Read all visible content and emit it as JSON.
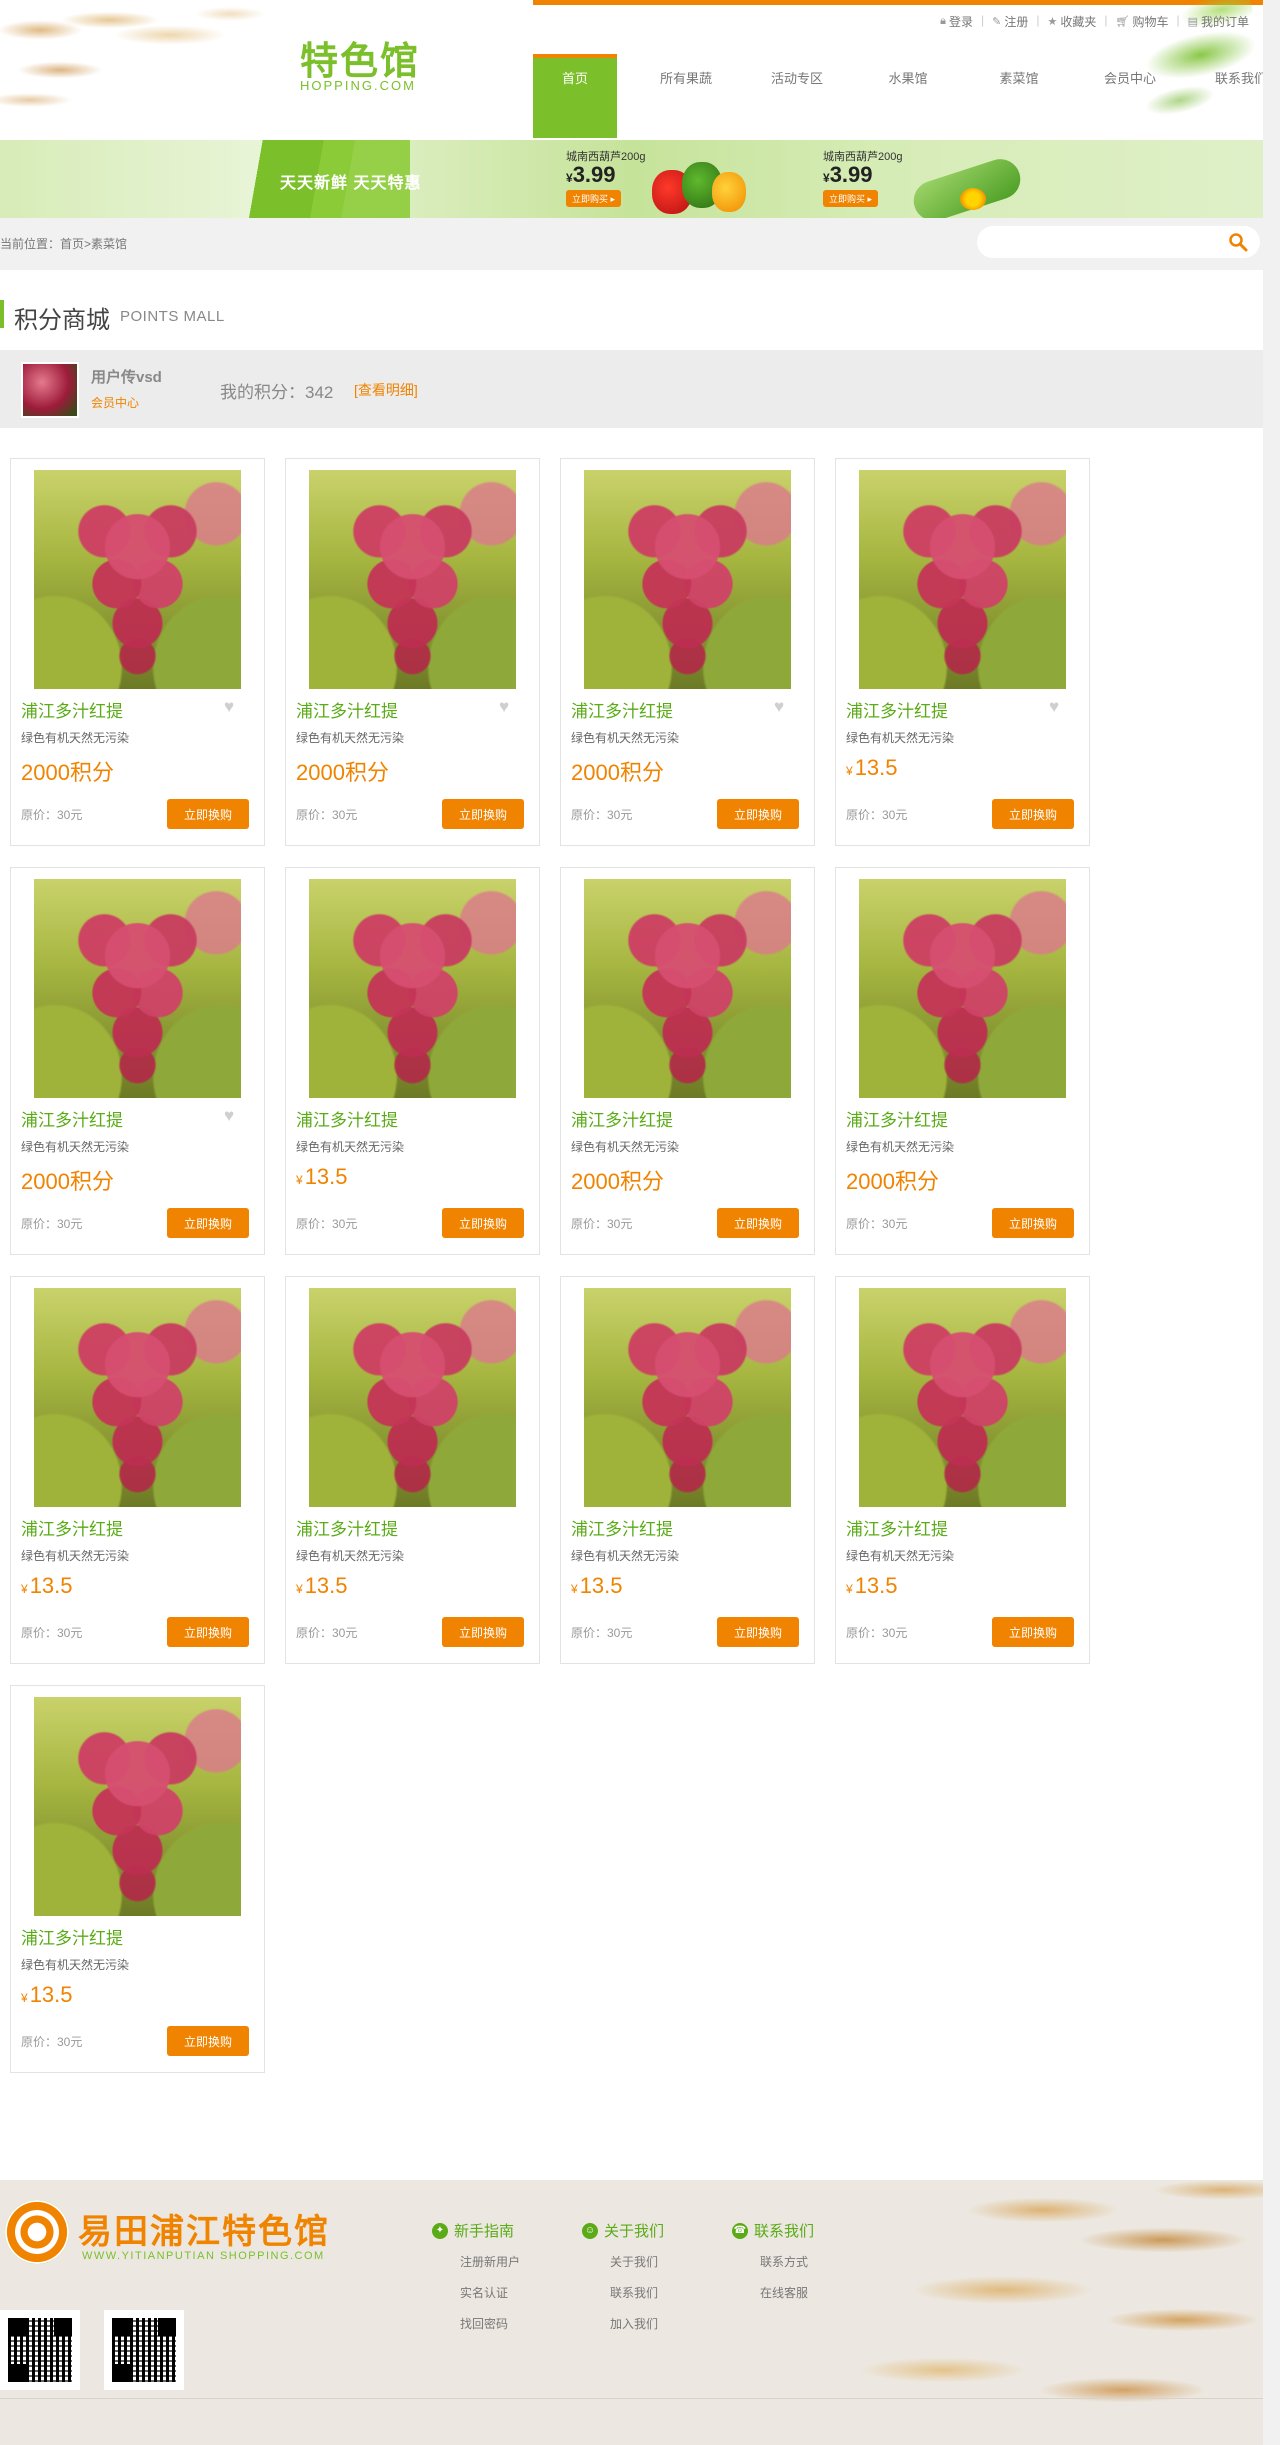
{
  "header": {
    "logo_cn": "特色馆",
    "logo_en": "HOPPING.COM",
    "top_links": [
      {
        "label": "登录",
        "icon": "lock-icon"
      },
      {
        "label": "注册",
        "icon": "pen-icon"
      },
      {
        "label": "收藏夹",
        "icon": "star-icon"
      },
      {
        "label": "购物车",
        "icon": "cart-icon"
      },
      {
        "label": "我的订单",
        "icon": "order-icon"
      }
    ],
    "nav": [
      "首页",
      "所有果蔬",
      "活动专区",
      "水果馆",
      "素菜馆",
      "会员中心",
      "联系我们"
    ],
    "nav_active": 0
  },
  "banner": {
    "slogan": "天天新鲜  天天特惠",
    "promos": [
      {
        "title": "城南西葫芦200g",
        "currency": "¥",
        "price": "3.99",
        "buy_label": "立即购买 ▸"
      },
      {
        "title": "城南西葫芦200g",
        "currency": "¥",
        "price": "3.99",
        "buy_label": "立即购买 ▸"
      }
    ]
  },
  "breadcrumb": {
    "prefix": "当前位置：",
    "path": "首页>素菜馆"
  },
  "search": {
    "placeholder": ""
  },
  "section": {
    "title_cn": "积分商城",
    "title_en": "POINTS MALL"
  },
  "user": {
    "name": "用户传vsd",
    "member_link": "会员中心",
    "points_label": "我的积分：",
    "points_value": "342",
    "detail_link": "[查看明细]"
  },
  "products": [
    {
      "name": "浦江多汁红提",
      "desc": "绿色有机天然无污染",
      "price_type": "points",
      "price": "2000积分",
      "orig": "原价：30元",
      "btn": "立即换购",
      "heart": true
    },
    {
      "name": "浦江多汁红提",
      "desc": "绿色有机天然无污染",
      "price_type": "points",
      "price": "2000积分",
      "orig": "原价：30元",
      "btn": "立即换购",
      "heart": true
    },
    {
      "name": "浦江多汁红提",
      "desc": "绿色有机天然无污染",
      "price_type": "points",
      "price": "2000积分",
      "orig": "原价：30元",
      "btn": "立即换购",
      "heart": true
    },
    {
      "name": "浦江多汁红提",
      "desc": "绿色有机天然无污染",
      "price_type": "cash",
      "currency": "¥",
      "price": "13.5",
      "orig": "原价：30元",
      "btn": "立即换购",
      "heart": true
    },
    {
      "name": "浦江多汁红提",
      "desc": "绿色有机天然无污染",
      "price_type": "points",
      "price": "2000积分",
      "orig": "原价：30元",
      "btn": "立即换购",
      "heart": true
    },
    {
      "name": "浦江多汁红提",
      "desc": "绿色有机天然无污染",
      "price_type": "cash",
      "currency": "¥",
      "price": "13.5",
      "orig": "原价：30元",
      "btn": "立即换购",
      "heart": false
    },
    {
      "name": "浦江多汁红提",
      "desc": "绿色有机天然无污染",
      "price_type": "points",
      "price": "2000积分",
      "orig": "原价：30元",
      "btn": "立即换购",
      "heart": false
    },
    {
      "name": "浦江多汁红提",
      "desc": "绿色有机天然无污染",
      "price_type": "points",
      "price": "2000积分",
      "orig": "原价：30元",
      "btn": "立即换购",
      "heart": false
    },
    {
      "name": "浦江多汁红提",
      "desc": "绿色有机天然无污染",
      "price_type": "cash",
      "currency": "¥",
      "price": "13.5",
      "orig": "原价：30元",
      "btn": "立即换购",
      "heart": false
    },
    {
      "name": "浦江多汁红提",
      "desc": "绿色有机天然无污染",
      "price_type": "cash",
      "currency": "¥",
      "price": "13.5",
      "orig": "原价：30元",
      "btn": "立即换购",
      "heart": false
    },
    {
      "name": "浦江多汁红提",
      "desc": "绿色有机天然无污染",
      "price_type": "cash",
      "currency": "¥",
      "price": "13.5",
      "orig": "原价：30元",
      "btn": "立即换购",
      "heart": false
    },
    {
      "name": "浦江多汁红提",
      "desc": "绿色有机天然无污染",
      "price_type": "cash",
      "currency": "¥",
      "price": "13.5",
      "orig": "原价：30元",
      "btn": "立即换购",
      "heart": false
    },
    {
      "name": "浦江多汁红提",
      "desc": "绿色有机天然无污染",
      "price_type": "cash",
      "currency": "¥",
      "price": "13.5",
      "orig": "原价：30元",
      "btn": "立即换购",
      "heart": false
    }
  ],
  "footer": {
    "logo_cn": "易田浦江特色馆",
    "logo_en": "WWW.YITIANPUTIAN SHOPPING.COM",
    "columns": [
      {
        "title": "新手指南",
        "icon": "compass-icon",
        "items": [
          "注册新用户",
          "实名认证",
          "找回密码"
        ]
      },
      {
        "title": "关于我们",
        "icon": "user-icon",
        "items": [
          "关于我们",
          "联系我们",
          "加入我们"
        ]
      },
      {
        "title": "联系我们",
        "icon": "person-icon",
        "items": [
          "联系方式",
          "在线客服"
        ]
      }
    ]
  },
  "colors": {
    "brand_green": "#7bbf2b",
    "accent_orange": "#f08300"
  }
}
